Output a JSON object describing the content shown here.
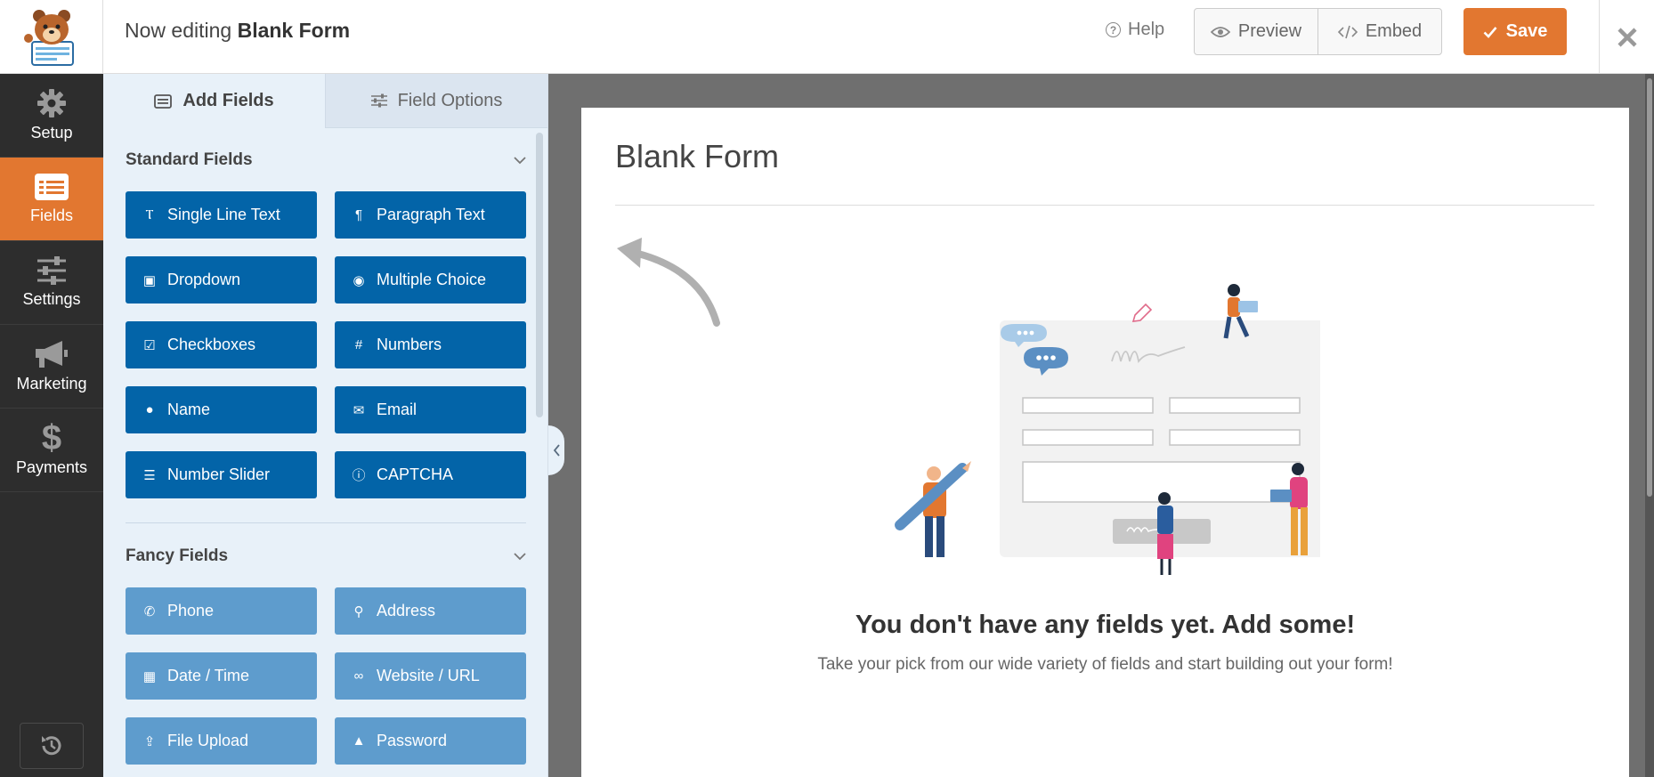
{
  "header": {
    "title_prefix": "Now editing",
    "form_name": "Blank Form",
    "help_label": "Help",
    "preview_label": "Preview",
    "embed_label": "Embed",
    "save_label": "Save"
  },
  "nav": {
    "items": [
      {
        "label": "Setup",
        "icon": "gear-icon"
      },
      {
        "label": "Fields",
        "icon": "fields-list-icon",
        "active": true
      },
      {
        "label": "Settings",
        "icon": "sliders-icon"
      },
      {
        "label": "Marketing",
        "icon": "megaphone-icon"
      },
      {
        "label": "Payments",
        "icon": "dollar-icon"
      }
    ]
  },
  "panel": {
    "tabs": [
      {
        "label": "Add Fields",
        "active": true
      },
      {
        "label": "Field Options",
        "active": false
      }
    ],
    "standard": {
      "title": "Standard Fields",
      "fields": [
        {
          "label": "Single Line Text",
          "icon": "text-icon"
        },
        {
          "label": "Paragraph Text",
          "icon": "paragraph-icon"
        },
        {
          "label": "Dropdown",
          "icon": "dropdown-icon"
        },
        {
          "label": "Multiple Choice",
          "icon": "radio-icon"
        },
        {
          "label": "Checkboxes",
          "icon": "checkbox-icon"
        },
        {
          "label": "Numbers",
          "icon": "hash-icon"
        },
        {
          "label": "Name",
          "icon": "user-icon"
        },
        {
          "label": "Email",
          "icon": "envelope-icon"
        },
        {
          "label": "Number Slider",
          "icon": "slider-icon"
        },
        {
          "label": "CAPTCHA",
          "icon": "question-icon"
        }
      ]
    },
    "fancy": {
      "title": "Fancy Fields",
      "fields": [
        {
          "label": "Phone",
          "icon": "phone-icon"
        },
        {
          "label": "Address",
          "icon": "map-pin-icon"
        },
        {
          "label": "Date / Time",
          "icon": "calendar-icon"
        },
        {
          "label": "Website / URL",
          "icon": "link-icon"
        },
        {
          "label": "File Upload",
          "icon": "upload-icon"
        },
        {
          "label": "Password",
          "icon": "lock-icon"
        }
      ]
    }
  },
  "preview": {
    "form_title": "Blank Form",
    "empty_heading": "You don't have any fields yet. Add some!",
    "empty_sub": "Take your pick from our wide variety of fields and start building out your form!"
  },
  "colors": {
    "accent": "#e27730",
    "field_button": "#0364a8",
    "fancy_button": "#5e9ccd",
    "nav_bg": "#2d2d2d",
    "panel_bg": "#e8f1f9"
  }
}
